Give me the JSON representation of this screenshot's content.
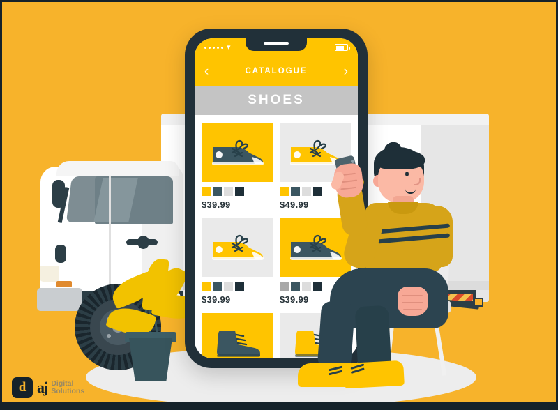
{
  "scene": {
    "background_color": "#F7B32B",
    "border_color": "#15222a",
    "title": "E-commerce shoe shopping illustration"
  },
  "phone": {
    "status_bar": {
      "signal_icon": "signal-dots-icon",
      "signal_dots": 5,
      "wifi_icon": "wifi-icon",
      "battery_icon": "battery-icon"
    },
    "nav": {
      "back_icon": "chevron-left-icon",
      "title": "CATALOGUE",
      "forward_icon": "chevron-right-icon"
    },
    "category_banner": {
      "label": "SHOES",
      "background_color": "#C4C4C4"
    },
    "products": [
      {
        "name": "Low-top sneaker",
        "thumb_style": "y",
        "shoe_color": "#3B5661",
        "swatches": [
          "#FFC400",
          "#3B5661",
          "#DDDDDD",
          "#1E2F38"
        ],
        "price": "$39.99"
      },
      {
        "name": "Yellow sneaker",
        "thumb_style": "g",
        "shoe_color": "#FFC400",
        "swatches": [
          "#FFC400",
          "#3B5661",
          "#DDDDDD",
          "#1E2F38"
        ],
        "price": "$49.99"
      },
      {
        "name": "Yellow runner",
        "thumb_style": "g",
        "shoe_color": "#FFC400",
        "swatches": [
          "#FFC400",
          "#3B5661",
          "#DDDDDD",
          "#1E2F38"
        ],
        "price": "$39.99"
      },
      {
        "name": "Dark slip-on",
        "thumb_style": "y",
        "shoe_color": "#3B5661",
        "swatches": [
          "#A8A8A8",
          "#3B5661",
          "#DDDDDD",
          "#1E2F38"
        ],
        "price": "$39.99"
      },
      {
        "name": "Dark boot",
        "thumb_style": "y",
        "shoe_color": "#3B5661",
        "swatches": [],
        "price": ""
      },
      {
        "name": "Yellow boot",
        "thumb_style": "g",
        "shoe_color": "#FFC400",
        "swatches": [],
        "price": ""
      }
    ]
  },
  "logo": {
    "badge_glyph": "d",
    "mark_glyph": "aj",
    "line1": "Digital",
    "line2": "Solutions"
  },
  "illustration": {
    "truck": "white delivery truck",
    "person": "seated man holding a smartphone",
    "plant": "potted plant with yellow leaves",
    "chair": "white chair"
  }
}
